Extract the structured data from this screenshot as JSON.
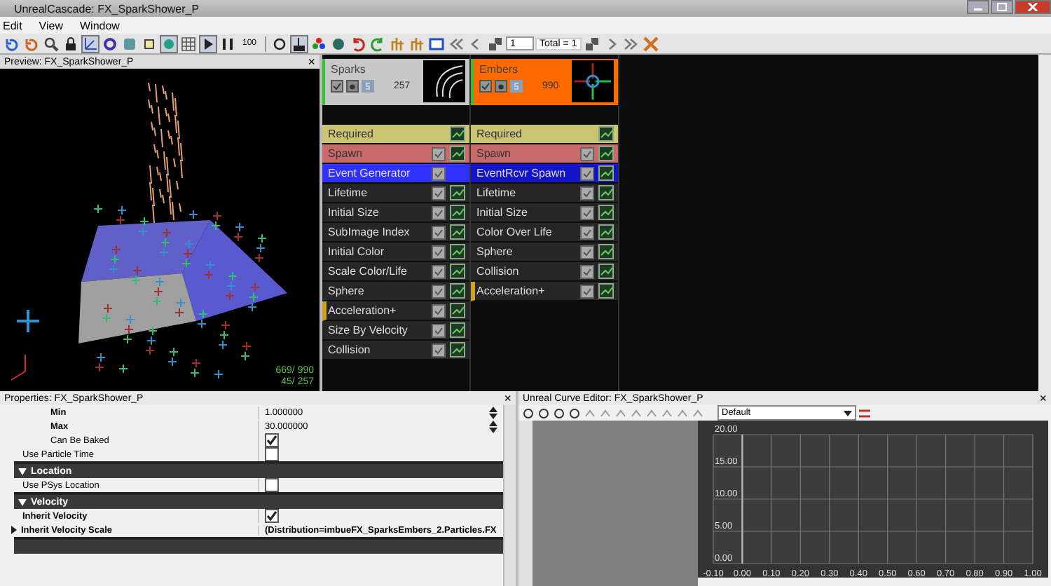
{
  "window": {
    "title": "UnrealCascade: FX_SparkShower_P"
  },
  "menu": [
    "Edit",
    "View",
    "Window"
  ],
  "toolbar": {
    "speed": "100",
    "page": "1",
    "total": "Total = 1"
  },
  "preview": {
    "title": "Preview: FX_SparkShower_P",
    "close": "×",
    "stats": [
      "669/ 990",
      "45/ 257"
    ]
  },
  "emitters": [
    {
      "name": "Sparks",
      "count": "257",
      "color": "#c8c8c8",
      "modules": [
        {
          "label": "Required",
          "kind": "required",
          "curve": true
        },
        {
          "label": "Spawn",
          "kind": "spawn",
          "curve": true
        },
        {
          "label": "Event Generator",
          "kind": "event",
          "curve": false
        },
        {
          "label": "Lifetime",
          "kind": "module",
          "curve": true
        },
        {
          "label": "Initial Size",
          "kind": "module",
          "curve": true
        },
        {
          "label": "SubImage Index",
          "kind": "module",
          "curve": true
        },
        {
          "label": "Initial Color",
          "kind": "module",
          "curve": true
        },
        {
          "label": "Scale Color/Life",
          "kind": "module",
          "curve": true
        },
        {
          "label": "Sphere",
          "kind": "module",
          "curve": true
        },
        {
          "label": "Acceleration+",
          "kind": "marked",
          "curve": true
        },
        {
          "label": "Size By Velocity",
          "kind": "module",
          "curve": true
        },
        {
          "label": "Collision",
          "kind": "module",
          "curve": true
        }
      ]
    },
    {
      "name": "Embers",
      "count": "990",
      "color": "#ff6a00",
      "modules": [
        {
          "label": "Required",
          "kind": "required",
          "curve": true
        },
        {
          "label": "Spawn",
          "kind": "spawn",
          "curve": true
        },
        {
          "label": "EventRcvr Spawn",
          "kind": "event",
          "curve": true
        },
        {
          "label": "Lifetime",
          "kind": "module",
          "curve": true
        },
        {
          "label": "Initial Size",
          "kind": "module",
          "curve": true
        },
        {
          "label": "Color Over Life",
          "kind": "module",
          "curve": true
        },
        {
          "label": "Sphere",
          "kind": "module",
          "curve": true
        },
        {
          "label": "Collision",
          "kind": "module",
          "curve": true
        },
        {
          "label": "Acceleration+",
          "kind": "marked",
          "curve": true
        }
      ]
    }
  ],
  "properties": {
    "title": "Properties: FX_SparkShower_P",
    "close": "×",
    "rows": [
      {
        "kind": "number",
        "label": "Min",
        "value": "1.000000"
      },
      {
        "kind": "number",
        "label": "Max",
        "value": "30.000000"
      },
      {
        "kind": "subcheck",
        "label": "Can Be Baked",
        "checked": true
      },
      {
        "kind": "check",
        "label": "Use Particle Time",
        "checked": false
      },
      {
        "kind": "section",
        "label": "Location"
      },
      {
        "kind": "check",
        "label": "Use PSys Location",
        "checked": false
      },
      {
        "kind": "section",
        "label": "Velocity"
      },
      {
        "kind": "check",
        "label": "Inherit Velocity",
        "checked": true,
        "bold": true
      },
      {
        "kind": "struct",
        "label": "Inherit Velocity Scale",
        "value": "(Distribution=imbueFX_SparksEmbers_2.Particles.FX"
      },
      {
        "kind": "section",
        "label": ""
      }
    ]
  },
  "curve_editor": {
    "title": "Unreal Curve Editor: FX_SparkShower_P",
    "close": "×",
    "preset": "Default",
    "chart_data": {
      "type": "line",
      "grid": true,
      "xlim": [
        -0.1,
        1.0
      ],
      "ylim": [
        0,
        20
      ],
      "xticks": [
        {
          "value": -0.1,
          "label": "-0.10"
        },
        {
          "value": 0,
          "label": "0.00"
        },
        {
          "value": 0.1,
          "label": "0.10"
        },
        {
          "value": 0.2,
          "label": "0.20"
        },
        {
          "value": 0.3,
          "label": "0.30"
        },
        {
          "value": 0.4,
          "label": "0.40"
        },
        {
          "value": 0.5,
          "label": "0.50"
        },
        {
          "value": 0.6,
          "label": "0.60"
        },
        {
          "value": 0.7,
          "label": "0.70"
        },
        {
          "value": 0.8,
          "label": "0.80"
        },
        {
          "value": 0.9,
          "label": "0.90"
        },
        {
          "value": 1.0,
          "label": "1.00"
        }
      ],
      "yticks": [
        {
          "value": 0,
          "label": "0.00"
        },
        {
          "value": 5,
          "label": "5.00"
        },
        {
          "value": 10,
          "label": "10.00"
        },
        {
          "value": 15,
          "label": "15.00"
        },
        {
          "value": 20,
          "label": "20.00"
        }
      ]
    }
  }
}
